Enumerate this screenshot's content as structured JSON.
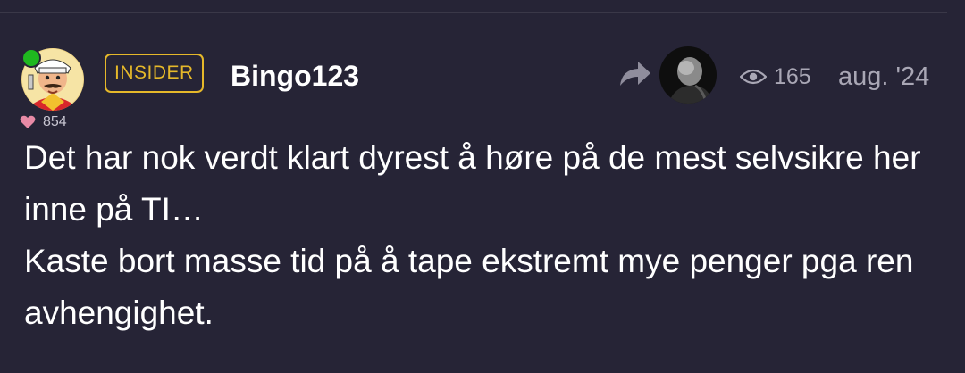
{
  "post": {
    "author": {
      "username": "Bingo123",
      "badge": "INSIDER",
      "avatar_icon": "cartoon-avatar",
      "online_status_color": "#1fb81f",
      "likes_count": "854",
      "likes_icon": "heart-icon"
    },
    "reply_to": {
      "icon": "reply-arrow-icon",
      "avatar_icon": "user-avatar-photo"
    },
    "views": {
      "icon": "eye-icon",
      "count": "165"
    },
    "date": "aug. '24",
    "body": {
      "paragraph_1": "Det har nok verdt klart dyrest å høre på de mest selvsikre her inne på TI…",
      "paragraph_2": "Kaste bort masse tid på å tape ekstremt mye penger pga ren avhengighet."
    }
  },
  "colors": {
    "background": "#262436",
    "badge_gold": "#e5b82a",
    "muted_text": "#a9a7b5",
    "heart": "#e88aa6"
  }
}
